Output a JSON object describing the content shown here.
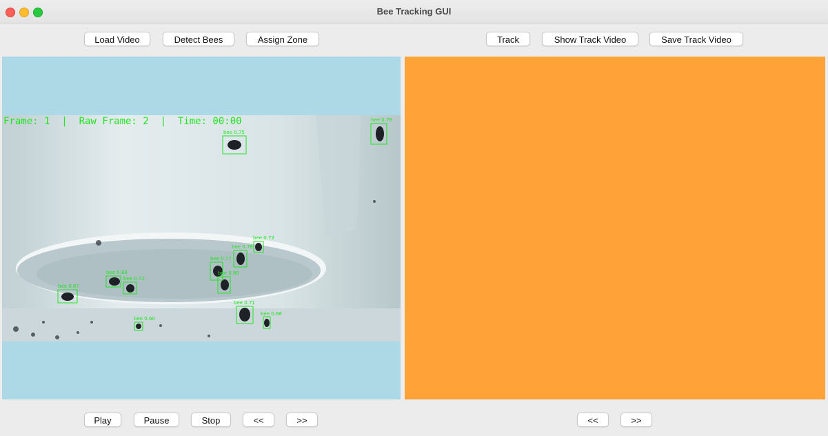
{
  "window": {
    "title": "Bee Tracking GUI"
  },
  "toolbar_left": {
    "load_video": "Load Video",
    "detect_bees": "Detect Bees",
    "assign_zone": "Assign Zone"
  },
  "toolbar_right": {
    "track": "Track",
    "show_track_video": "Show Track Video",
    "save_track_video": "Save Track Video"
  },
  "video": {
    "overlay_text": "Frame: 1  |  Raw Frame: 2  |  Time: 00:00",
    "detection_label_prefix": "bee",
    "detections": [
      "0.75",
      "0.78",
      "0.67",
      "0.68",
      "0.72",
      "0.60",
      "0.73",
      "0.76",
      "0.77",
      "0.80",
      "0.71",
      "0.68"
    ]
  },
  "controls_left": {
    "play": "Play",
    "pause": "Pause",
    "stop": "Stop",
    "prev": "<<",
    "next": ">>"
  },
  "controls_right": {
    "prev": "<<",
    "next": ">>"
  },
  "colors": {
    "left_panel_bg": "#add8e6",
    "right_panel_bg": "#ffa237",
    "detection_box": "#22e322"
  }
}
